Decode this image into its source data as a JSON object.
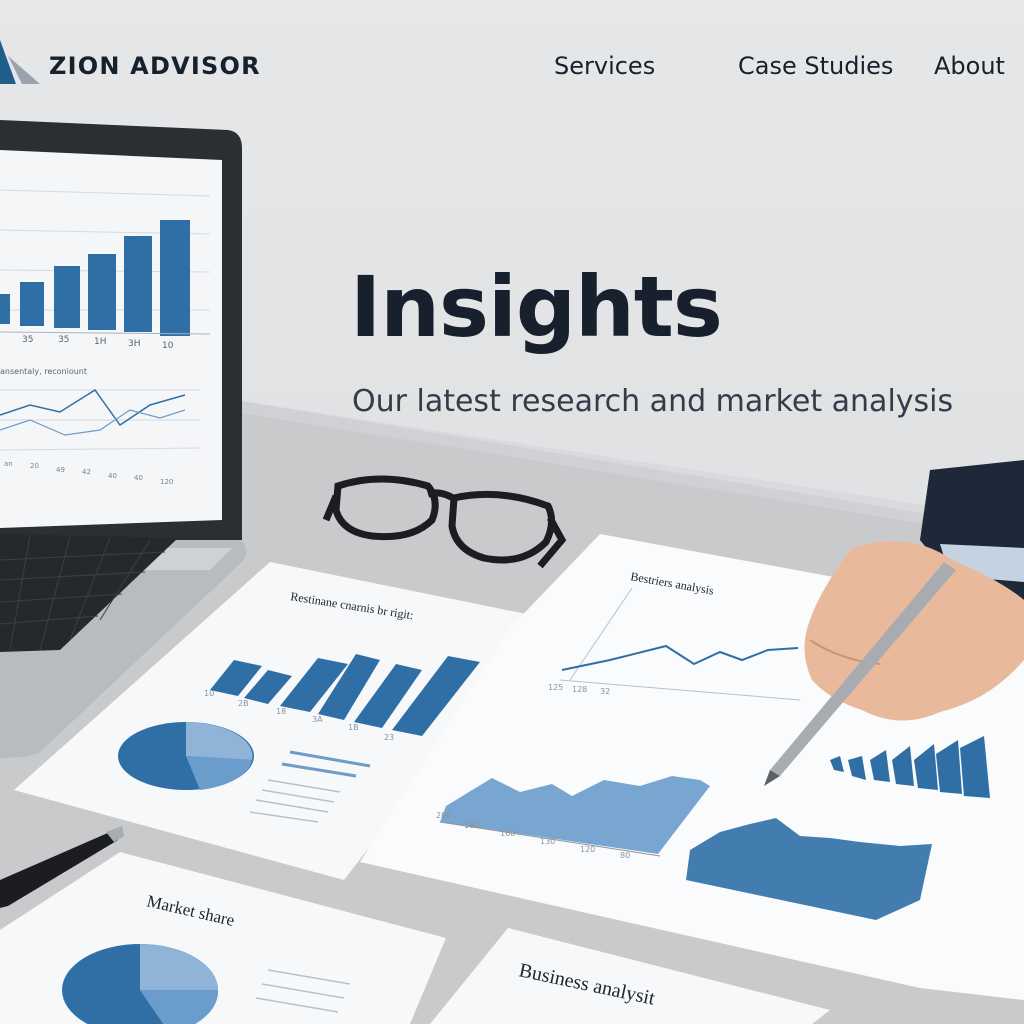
{
  "brand": {
    "name": "ZION ADVISOR",
    "colors": {
      "accent": "#1f5d8a",
      "mark_light": "#9aa3ad",
      "text": "#16212e"
    }
  },
  "nav": {
    "items": [
      {
        "label": "Services"
      },
      {
        "label": "Case Studies"
      },
      {
        "label": "About"
      }
    ]
  },
  "hero": {
    "title": "Insights",
    "subtitle": "Our latest research and market analysis"
  },
  "scene": {
    "documents": [
      {
        "title": "Restinane cnarnis br rigit:"
      },
      {
        "title": "Bestriers analysis"
      },
      {
        "title": "Market share"
      },
      {
        "title": "Business analysit"
      }
    ],
    "laptop": {
      "sublabel": "ansentaly, reconiount"
    },
    "colors": {
      "chart_blue": "#2f6fa6",
      "chart_light": "#7fa7cf",
      "desk": "#c9cbcd"
    }
  }
}
